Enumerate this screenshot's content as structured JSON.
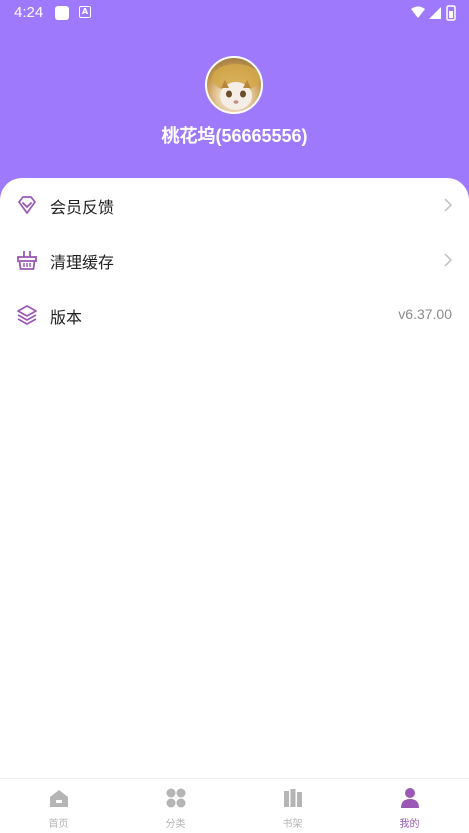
{
  "status_bar": {
    "time": "4:24",
    "notif_badge": "A"
  },
  "profile": {
    "username": "桃花坞(56665556)"
  },
  "menu": [
    {
      "label": "会员反馈",
      "icon": "diamond-icon",
      "trailing": "chevron"
    },
    {
      "label": "清理缓存",
      "icon": "basket-icon",
      "trailing": "chevron"
    },
    {
      "label": "版本",
      "icon": "layers-icon",
      "value": "v6.37.00"
    }
  ],
  "bottom_nav": {
    "tabs": [
      {
        "label": "首页",
        "icon": "home-icon",
        "active": false
      },
      {
        "label": "分类",
        "icon": "grid-icon",
        "active": false
      },
      {
        "label": "书架",
        "icon": "bookshelf-icon",
        "active": false
      },
      {
        "label": "我的",
        "icon": "person-icon",
        "active": true
      }
    ]
  },
  "colors": {
    "header": "#9f79fb",
    "accent": "#9b59b6",
    "inactive": "#b5b5b5"
  }
}
